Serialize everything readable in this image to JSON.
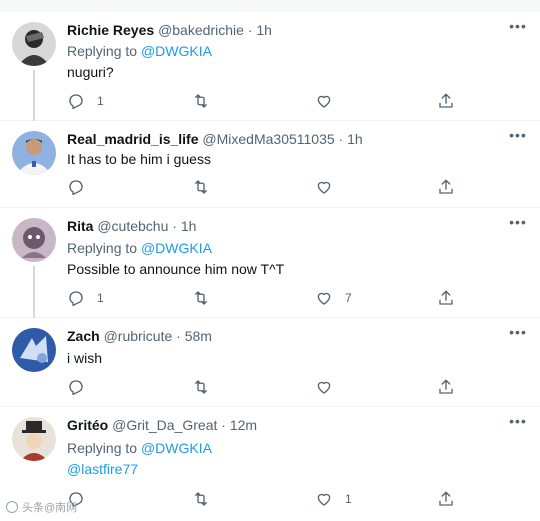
{
  "tweets": [
    {
      "name": "Richie Reyes",
      "meta": "@bakedrichie · 1h",
      "replying_prefix": "Replying to ",
      "replying_handle": "@DWGKIA",
      "text": "nuguri?",
      "reply_count": "1",
      "retweet_count": "",
      "like_count": "",
      "avatar_colors": [
        "#2a2a2a",
        "#6b6b6b"
      ]
    },
    {
      "name": "Real_madrid_is_life",
      "meta": "@MixedMa30511035 · 1h",
      "text": "It has to be him i guess",
      "reply_count": "",
      "retweet_count": "",
      "like_count": "",
      "avatar_colors": [
        "#8fb3e0",
        "#d9c2a8"
      ]
    },
    {
      "name": "Rita",
      "meta": "@cutebchu · 1h",
      "replying_prefix": "Replying to ",
      "replying_handle": "@DWGKIA",
      "text": "Possible to announce him now T^T",
      "reply_count": "1",
      "retweet_count": "",
      "like_count": "7",
      "avatar_colors": [
        "#c9b7c7",
        "#6c5a6a"
      ]
    },
    {
      "name": "Zach",
      "meta": "@rubricute · 58m",
      "text": "i wish",
      "reply_count": "",
      "retweet_count": "",
      "like_count": "",
      "avatar_colors": [
        "#2e5aa8",
        "#cfe0f5"
      ]
    },
    {
      "name": "Gritéo",
      "meta": "@Grit_Da_Great · 12m",
      "replying_prefix": "Replying to ",
      "replying_handle": "@DWGKIA",
      "mention": "@lastfire77",
      "reply_count": "",
      "retweet_count": "",
      "like_count": "1",
      "avatar_colors": [
        "#e8e2d8",
        "#a83a2e"
      ]
    }
  ],
  "watermark": "头条@南网"
}
